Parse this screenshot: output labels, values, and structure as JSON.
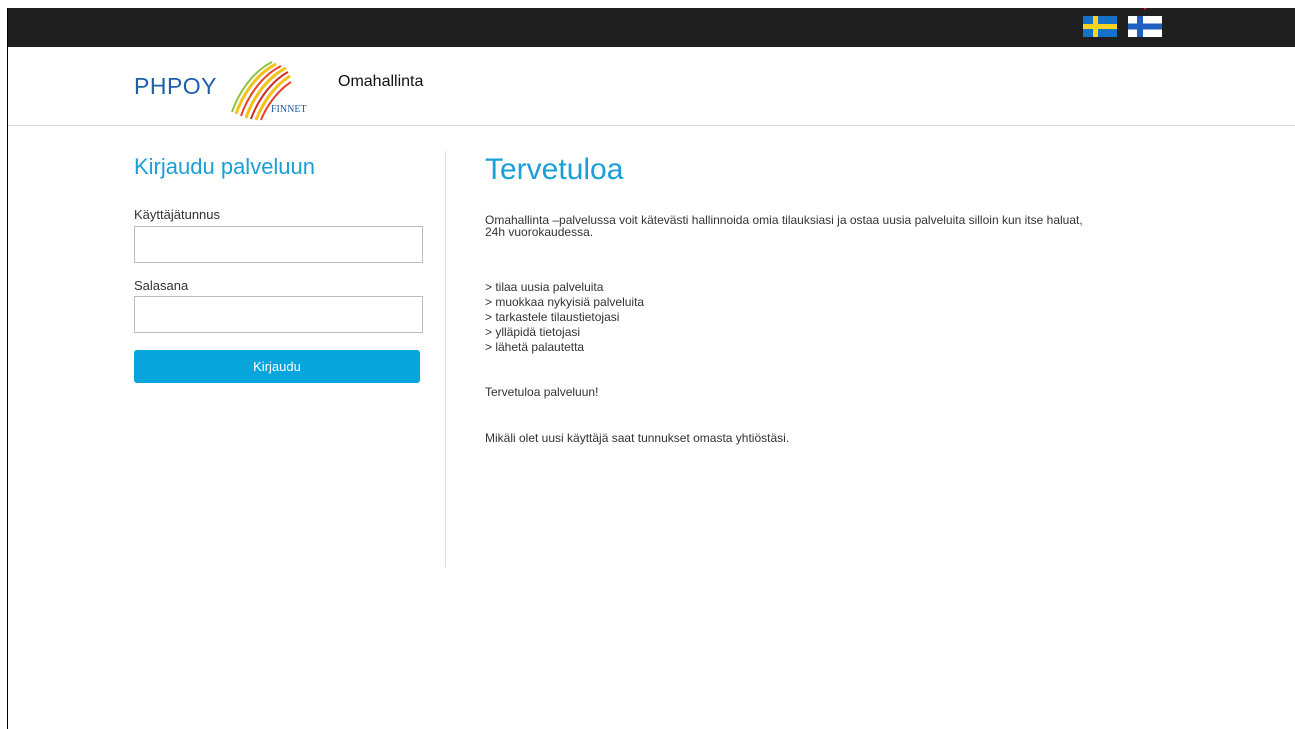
{
  "header": {
    "brand": "PHPOY",
    "brand_sub": "FINNET",
    "app_name": "Omahallinta"
  },
  "languages": [
    {
      "code": "sv",
      "icon": "sweden-flag-icon"
    },
    {
      "code": "fi",
      "icon": "finland-flag-icon"
    }
  ],
  "login": {
    "title": "Kirjaudu palveluun",
    "username_label": "Käyttäjätunnus",
    "username_value": "",
    "password_label": "Salasana",
    "password_value": "",
    "submit_label": "Kirjaudu"
  },
  "welcome": {
    "title": "Tervetuloa",
    "intro": "Omahallinta –palvelussa voit kätevästi hallinnoida omia tilauksiasi ja ostaa uusia palveluita silloin kun itse haluat, 24h vuorokaudessa.",
    "features": [
      "> tilaa uusia palveluita",
      "> muokkaa nykyisiä palveluita",
      "> tarkastele tilaustietojasi",
      "> ylläpidä tietojasi",
      "> lähetä palautetta"
    ],
    "greeting": "Tervetuloa palveluun!",
    "new_user_note": "Mikäli olet uusi käyttäjä saat tunnukset omasta yhtiöstäsi."
  },
  "colors": {
    "accent": "#1aa0d6",
    "button": "#06a6dc",
    "topbar": "#1f1f1f",
    "brand": "#1f5ea8",
    "marker": "#e02020"
  }
}
